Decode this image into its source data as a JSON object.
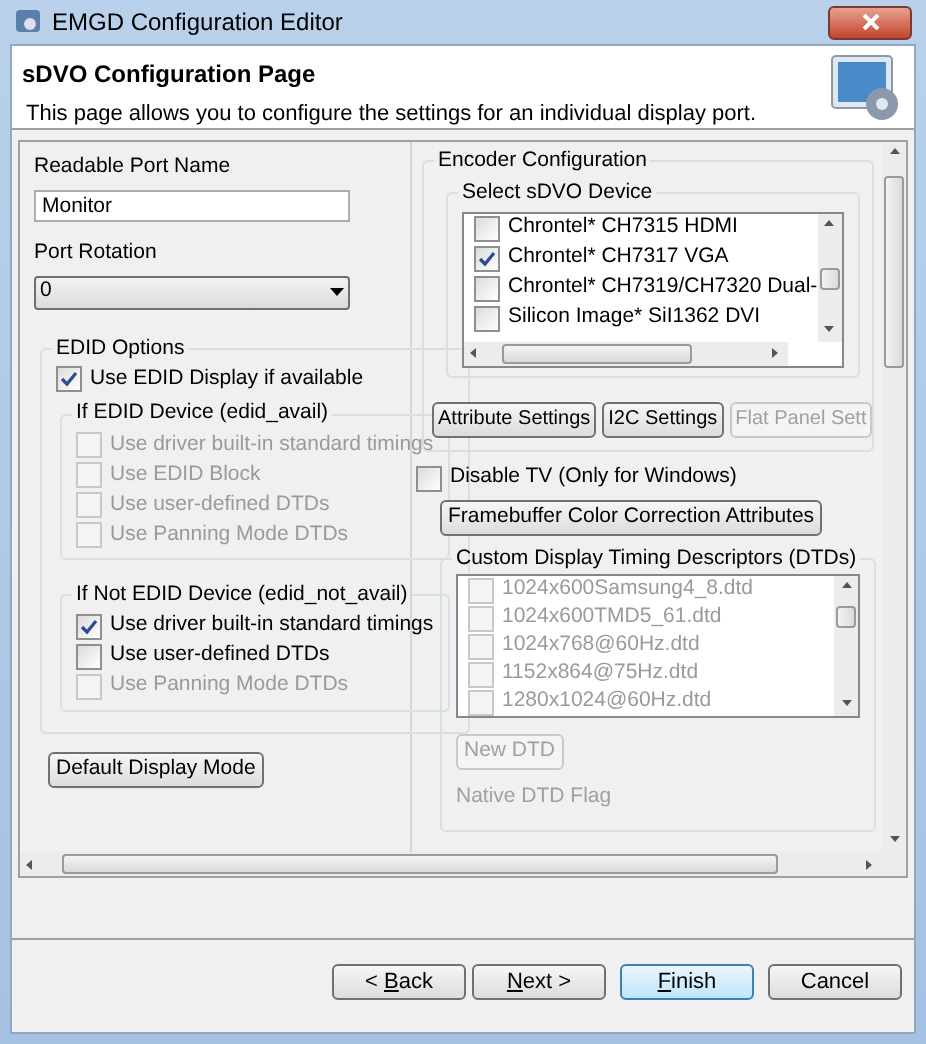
{
  "window": {
    "title": "EMGD Configuration Editor"
  },
  "header": {
    "title": "sDVO Configuration Page",
    "description": "This page allows you to configure the settings for an individual display port."
  },
  "port_name": {
    "label": "Readable Port Name",
    "value": "Monitor"
  },
  "port_rotation": {
    "label": "Port Rotation",
    "value": "0"
  },
  "edid_options": {
    "title": "EDID Options",
    "use_edid": {
      "label": "Use EDID Display if available",
      "checked": true,
      "disabled": false
    },
    "groups": [
      {
        "title": "If EDID Device (edid_avail)",
        "items": [
          {
            "label": "Use driver built-in standard timings",
            "checked": false,
            "disabled": true
          },
          {
            "label": "Use EDID Block",
            "checked": false,
            "disabled": true
          },
          {
            "label": "Use user-defined DTDs",
            "checked": false,
            "disabled": true
          },
          {
            "label": "Use Panning Mode DTDs",
            "checked": false,
            "disabled": true
          }
        ]
      },
      {
        "title": "If Not EDID Device (edid_not_avail)",
        "items": [
          {
            "label": "Use driver built-in standard timings",
            "checked": true,
            "disabled": false
          },
          {
            "label": "Use user-defined DTDs",
            "checked": false,
            "disabled": false
          },
          {
            "label": "Use Panning Mode DTDs",
            "checked": false,
            "disabled": true
          }
        ]
      }
    ]
  },
  "default_display_mode_button": {
    "label": "Default Display Mode",
    "disabled": false
  },
  "encoder": {
    "title": "Encoder Configuration",
    "device_group": {
      "title": "Select sDVO Device",
      "devices": [
        {
          "label": "Chrontel* CH7315 HDMI",
          "checked": false
        },
        {
          "label": "Chrontel* CH7317 VGA",
          "checked": true
        },
        {
          "label": "Chrontel* CH7319/CH7320 Dual-",
          "checked": false
        },
        {
          "label": "Silicon Image* SiI1362 DVI",
          "checked": false
        }
      ]
    },
    "buttons": [
      {
        "label": "Attribute Settings",
        "disabled": false
      },
      {
        "label": "I2C Settings",
        "disabled": false
      },
      {
        "label": "Flat Panel Sett",
        "disabled": true
      }
    ]
  },
  "disable_tv": {
    "label": "Disable TV (Only for Windows)",
    "checked": false,
    "disabled": false
  },
  "framebuffer_button": {
    "label": "Framebuffer Color Correction Attributes",
    "disabled": false
  },
  "dtd_group": {
    "title": "Custom Display Timing Descriptors (DTDs)",
    "items": [
      {
        "label": "1024x600Samsung4_8.dtd",
        "checked": false,
        "disabled": true
      },
      {
        "label": "1024x600TMD5_61.dtd",
        "checked": false,
        "disabled": true
      },
      {
        "label": "1024x768@60Hz.dtd",
        "checked": false,
        "disabled": true
      },
      {
        "label": "1152x864@75Hz.dtd",
        "checked": false,
        "disabled": true
      },
      {
        "label": "1280x1024@60Hz.dtd",
        "checked": false,
        "disabled": true
      }
    ],
    "new_dtd_button": {
      "label": "New DTD",
      "disabled": true
    },
    "native_dtd_flag": {
      "label": "Native DTD Flag",
      "disabled": true
    }
  },
  "footer_buttons": [
    {
      "before": "< ",
      "key": "B",
      "after": "ack",
      "default": false
    },
    {
      "key": "N",
      "after": "ext >",
      "default": false
    },
    {
      "key": "F",
      "after": "inish",
      "default": true
    },
    {
      "before": "Cancel",
      "default": false
    }
  ]
}
